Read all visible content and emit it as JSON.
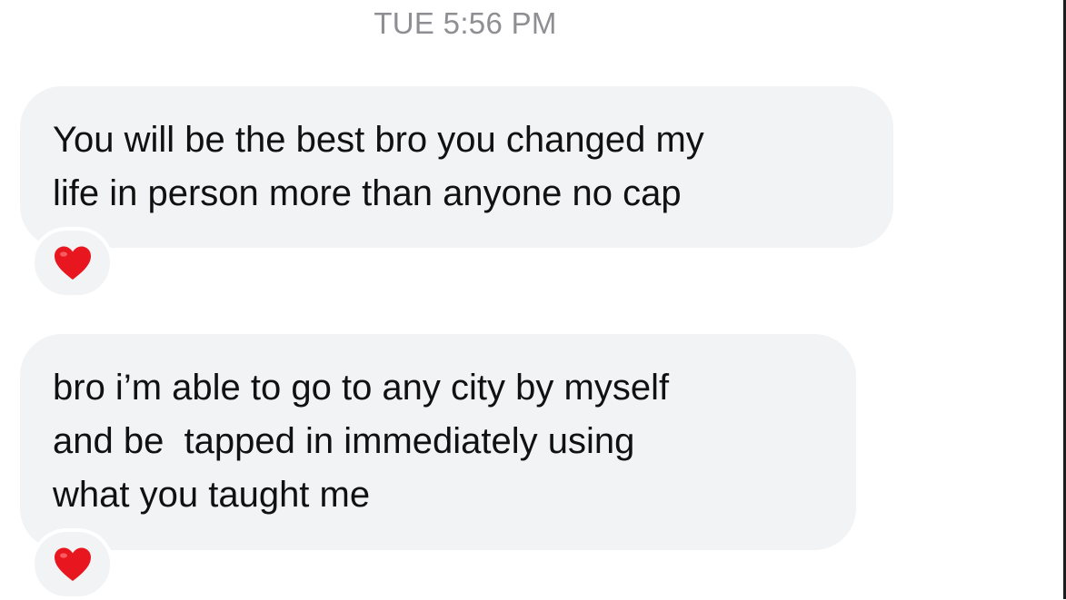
{
  "timestamp": "TUE 5:56 PM",
  "messages": [
    {
      "lines": [
        "You will be the best bro you changed my",
        "life in person more than anyone no cap"
      ],
      "reaction": "heart-icon"
    },
    {
      "lines": [
        "bro i’m able to go to any city by myself",
        "and be  tapped in immediately using",
        "what you taught me"
      ],
      "reaction": "heart-icon"
    }
  ],
  "colors": {
    "bubble": "#f2f3f5",
    "timestamp": "#8e8e93",
    "text": "#111111",
    "heart": "#e8161e"
  }
}
